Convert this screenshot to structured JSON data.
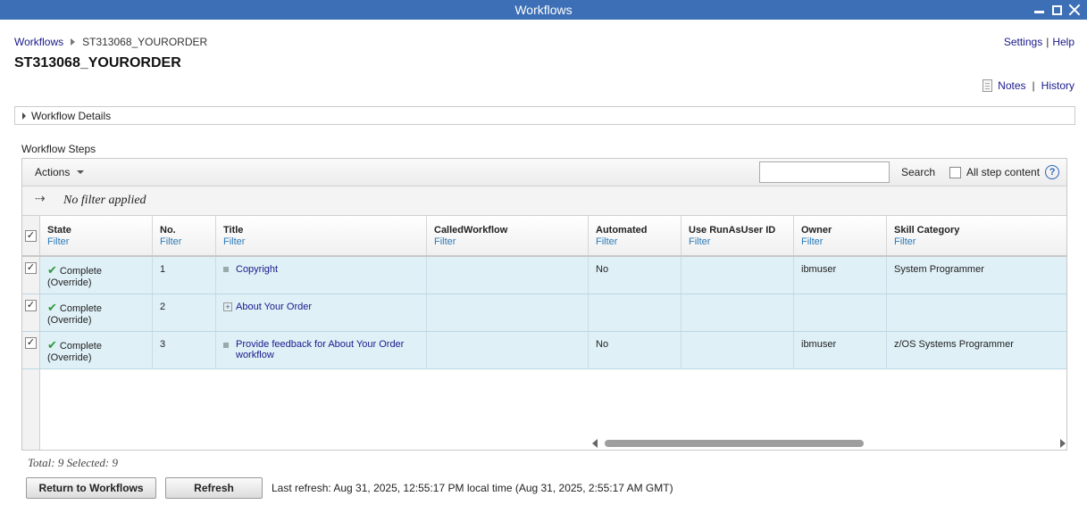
{
  "window": {
    "title": "Workflows"
  },
  "breadcrumb": {
    "root": "Workflows",
    "current": "ST313068_YOURORDER"
  },
  "top_links": {
    "settings": "Settings",
    "help": "Help",
    "separator": "|"
  },
  "page_title": "ST313068_YOURORDER",
  "notes_links": {
    "notes": "Notes",
    "history": "History",
    "separator": "|"
  },
  "details_panel": {
    "label": "Workflow Details"
  },
  "steps": {
    "label": "Workflow Steps",
    "toolbar": {
      "actions_label": "Actions",
      "search_value": "",
      "search_label": "Search",
      "all_step_content_label": "All step content",
      "help_glyph": "?"
    },
    "filter_text": "No filter applied",
    "columns": [
      {
        "name": "State",
        "filter": "Filter"
      },
      {
        "name": "No.",
        "filter": "Filter"
      },
      {
        "name": "Title",
        "filter": "Filter"
      },
      {
        "name": "CalledWorkflow",
        "filter": "Filter"
      },
      {
        "name": "Automated",
        "filter": "Filter"
      },
      {
        "name": "Use RunAsUser ID",
        "filter": "Filter"
      },
      {
        "name": "Owner",
        "filter": "Filter"
      },
      {
        "name": "Skill Category",
        "filter": "Filter"
      }
    ],
    "rows": [
      {
        "state": "Complete",
        "state_note": "(Override)",
        "no": "1",
        "title": "Copyright",
        "called": "",
        "automated": "No",
        "runas": "",
        "owner": "ibmuser",
        "skill": "System Programmer"
      },
      {
        "state": "Complete",
        "state_note": "(Override)",
        "no": "2",
        "title": "About Your Order",
        "called": "",
        "automated": "",
        "runas": "",
        "owner": "",
        "skill": ""
      },
      {
        "state": "Complete",
        "state_note": "(Override)",
        "no": "3",
        "title": "Provide feedback for About Your Order workflow",
        "called": "",
        "automated": "No",
        "runas": "",
        "owner": "ibmuser",
        "skill": "z/OS Systems Programmer"
      }
    ]
  },
  "totals": "Total: 9 Selected: 9",
  "buttons": {
    "return": "Return to Workflows",
    "refresh": "Refresh"
  },
  "last_refresh": "Last refresh: Aug 31, 2025, 12:55:17 PM local time (Aug 31, 2025, 2:55:17 AM GMT)"
}
